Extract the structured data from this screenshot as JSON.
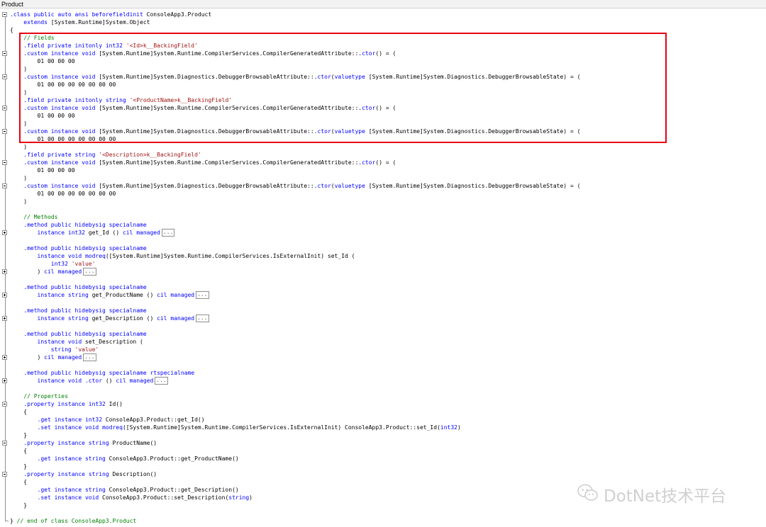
{
  "window": {
    "title": "Product"
  },
  "colors": {
    "keyword": "#0000ff",
    "comment": "#008000",
    "string": "#a31515",
    "text": "#000000",
    "highlight_box": "#e60012",
    "watermark": "#d0d0d0"
  },
  "code_lines": [
    [
      [
        ".class public auto ansi beforefieldinit",
        "kw"
      ],
      [
        " ConsoleApp3.Product",
        ""
      ]
    ],
    [
      [
        "    extends",
        "kw"
      ],
      [
        " [System.Runtime]System.Object",
        ""
      ]
    ],
    [
      [
        "{",
        ""
      ]
    ],
    [
      [
        "    // Fields",
        "cm"
      ]
    ],
    [
      [
        "    .field private initonly int32",
        "kw"
      ],
      [
        " ",
        ""
      ],
      [
        "'<Id>k__BackingField'",
        "st"
      ]
    ],
    [
      [
        "    .custom instance void",
        "kw"
      ],
      [
        " [System.Runtime]System.Runtime.CompilerServices.CompilerGeneratedAttribute::",
        ""
      ],
      [
        ".ctor",
        "kw"
      ],
      [
        "() = (",
        ""
      ]
    ],
    [
      [
        "        01 00 00 00",
        ""
      ]
    ],
    [
      [
        "    )",
        ""
      ]
    ],
    [
      [
        "    .custom instance void",
        "kw"
      ],
      [
        " [System.Runtime]System.Diagnostics.DebuggerBrowsableAttribute::",
        ""
      ],
      [
        ".ctor",
        "kw"
      ],
      [
        "(",
        ""
      ],
      [
        "valuetype",
        "kw"
      ],
      [
        " [System.Runtime]System.Diagnostics.DebuggerBrowsableState) = (",
        ""
      ]
    ],
    [
      [
        "        01 00 00 00 00 00 00 00",
        ""
      ]
    ],
    [
      [
        "    )",
        ""
      ]
    ],
    [
      [
        "    .field private initonly string",
        "kw"
      ],
      [
        " ",
        ""
      ],
      [
        "'<ProductName>k__BackingField'",
        "st"
      ]
    ],
    [
      [
        "    .custom instance void",
        "kw"
      ],
      [
        " [System.Runtime]System.Runtime.CompilerServices.CompilerGeneratedAttribute::",
        ""
      ],
      [
        ".ctor",
        "kw"
      ],
      [
        "() = (",
        ""
      ]
    ],
    [
      [
        "        01 00 00 00",
        ""
      ]
    ],
    [
      [
        "    )",
        ""
      ]
    ],
    [
      [
        "    .custom instance void",
        "kw"
      ],
      [
        " [System.Runtime]System.Diagnostics.DebuggerBrowsableAttribute::",
        ""
      ],
      [
        ".ctor",
        "kw"
      ],
      [
        "(",
        ""
      ],
      [
        "valuetype",
        "kw"
      ],
      [
        " [System.Runtime]System.Diagnostics.DebuggerBrowsableState) = (",
        ""
      ]
    ],
    [
      [
        "        01 00 00 00 00 00 00 00",
        ""
      ]
    ],
    [
      [
        "    )",
        ""
      ]
    ],
    [
      [
        "    .field private string",
        "kw"
      ],
      [
        " ",
        ""
      ],
      [
        "'<Description>k__BackingField'",
        "st"
      ]
    ],
    [
      [
        "    .custom instance void",
        "kw"
      ],
      [
        " [System.Runtime]System.Runtime.CompilerServices.CompilerGeneratedAttribute::",
        ""
      ],
      [
        ".ctor",
        "kw"
      ],
      [
        "() = (",
        ""
      ]
    ],
    [
      [
        "        01 00 00 00",
        ""
      ]
    ],
    [
      [
        "    )",
        ""
      ]
    ],
    [
      [
        "    .custom instance void",
        "kw"
      ],
      [
        " [System.Runtime]System.Diagnostics.DebuggerBrowsableAttribute::",
        ""
      ],
      [
        ".ctor",
        "kw"
      ],
      [
        "(",
        ""
      ],
      [
        "valuetype",
        "kw"
      ],
      [
        " [System.Runtime]System.Diagnostics.DebuggerBrowsableState) = (",
        ""
      ]
    ],
    [
      [
        "        01 00 00 00 00 00 00 00",
        ""
      ]
    ],
    [
      [
        "    )",
        ""
      ]
    ],
    [
      [
        "",
        ""
      ]
    ],
    [
      [
        "    // Methods",
        "cm"
      ]
    ],
    [
      [
        "    .method public hidebysig specialname",
        "kw"
      ]
    ],
    [
      [
        "        instance int32",
        "kw"
      ],
      [
        " get_Id () ",
        ""
      ],
      [
        "cil managed",
        "kw"
      ],
      [
        "...",
        "ell"
      ]
    ],
    [
      [
        "",
        ""
      ]
    ],
    [
      [
        "    .method public hidebysig specialname",
        "kw"
      ]
    ],
    [
      [
        "        instance void modreq",
        "kw"
      ],
      [
        "([System.Runtime]System.Runtime.CompilerServices.IsExternalInit) set_Id (",
        ""
      ]
    ],
    [
      [
        "            int32",
        "kw"
      ],
      [
        " ",
        ""
      ],
      [
        "'value'",
        "st"
      ]
    ],
    [
      [
        "        ) ",
        ""
      ],
      [
        "cil managed",
        "kw"
      ],
      [
        "...",
        "ell"
      ]
    ],
    [
      [
        "",
        ""
      ]
    ],
    [
      [
        "    .method public hidebysig specialname",
        "kw"
      ]
    ],
    [
      [
        "        instance string",
        "kw"
      ],
      [
        " get_ProductName () ",
        ""
      ],
      [
        "cil managed",
        "kw"
      ],
      [
        "...",
        "ell"
      ]
    ],
    [
      [
        "",
        ""
      ]
    ],
    [
      [
        "    .method public hidebysig specialname",
        "kw"
      ]
    ],
    [
      [
        "        instance string",
        "kw"
      ],
      [
        " get_Description () ",
        ""
      ],
      [
        "cil managed",
        "kw"
      ],
      [
        "...",
        "ell"
      ]
    ],
    [
      [
        "",
        ""
      ]
    ],
    [
      [
        "    .method public hidebysig specialname",
        "kw"
      ]
    ],
    [
      [
        "        instance void",
        "kw"
      ],
      [
        " set_Description (",
        ""
      ]
    ],
    [
      [
        "            string",
        "kw"
      ],
      [
        " ",
        ""
      ],
      [
        "'value'",
        "st"
      ]
    ],
    [
      [
        "        ) ",
        ""
      ],
      [
        "cil managed",
        "kw"
      ],
      [
        "...",
        "ell"
      ]
    ],
    [
      [
        "",
        ""
      ]
    ],
    [
      [
        "    .method public hidebysig specialname rtspecialname",
        "kw"
      ]
    ],
    [
      [
        "        instance void .ctor",
        "kw"
      ],
      [
        " () ",
        ""
      ],
      [
        "cil managed",
        "kw"
      ],
      [
        "...",
        "ell"
      ]
    ],
    [
      [
        "",
        ""
      ]
    ],
    [
      [
        "    // Properties",
        "cm"
      ]
    ],
    [
      [
        "    .property instance int32",
        "kw"
      ],
      [
        " Id()",
        ""
      ]
    ],
    [
      [
        "    {",
        ""
      ]
    ],
    [
      [
        "        .get instance int32",
        "kw"
      ],
      [
        " ConsoleApp3.Product::get_Id()",
        ""
      ]
    ],
    [
      [
        "        .set instance void modreq",
        "kw"
      ],
      [
        "([System.Runtime]System.Runtime.CompilerServices.IsExternalInit) ConsoleApp3.Product::set_Id(",
        ""
      ],
      [
        "int32",
        "kw"
      ],
      [
        ")",
        ""
      ]
    ],
    [
      [
        "    }",
        ""
      ]
    ],
    [
      [
        "    .property instance string",
        "kw"
      ],
      [
        " ProductName()",
        ""
      ]
    ],
    [
      [
        "    {",
        ""
      ]
    ],
    [
      [
        "        .get instance string",
        "kw"
      ],
      [
        " ConsoleApp3.Product::get_ProductName()",
        ""
      ]
    ],
    [
      [
        "    }",
        ""
      ]
    ],
    [
      [
        "    .property instance string",
        "kw"
      ],
      [
        " Description()",
        ""
      ]
    ],
    [
      [
        "    {",
        ""
      ]
    ],
    [
      [
        "        .get instance string",
        "kw"
      ],
      [
        " ConsoleApp3.Product::get_Description()",
        ""
      ]
    ],
    [
      [
        "        .set instance void",
        "kw"
      ],
      [
        " ConsoleApp3.Product::set_Description(",
        ""
      ],
      [
        "string",
        "kw"
      ],
      [
        ")",
        ""
      ]
    ],
    [
      [
        "    }",
        ""
      ]
    ],
    [
      [
        "",
        ""
      ]
    ],
    [
      [
        "} ",
        ""
      ],
      [
        "// end of class ConsoleApp3.Product",
        "cm"
      ]
    ]
  ],
  "fold_markers": [
    {
      "line": 0,
      "kind": "minus"
    },
    {
      "line": 5,
      "kind": "minus"
    },
    {
      "line": 8,
      "kind": "minus"
    },
    {
      "line": 12,
      "kind": "minus"
    },
    {
      "line": 15,
      "kind": "minus"
    },
    {
      "line": 19,
      "kind": "minus"
    },
    {
      "line": 22,
      "kind": "minus"
    },
    {
      "line": 28,
      "kind": "plus"
    },
    {
      "line": 33,
      "kind": "plus"
    },
    {
      "line": 36,
      "kind": "plus"
    },
    {
      "line": 39,
      "kind": "plus"
    },
    {
      "line": 44,
      "kind": "plus"
    },
    {
      "line": 47,
      "kind": "plus"
    },
    {
      "line": 50,
      "kind": "minus"
    },
    {
      "line": 55,
      "kind": "minus"
    },
    {
      "line": 59,
      "kind": "minus"
    }
  ],
  "watermark": {
    "text": "DotNet技术平台",
    "icon": "wechat-icon"
  }
}
